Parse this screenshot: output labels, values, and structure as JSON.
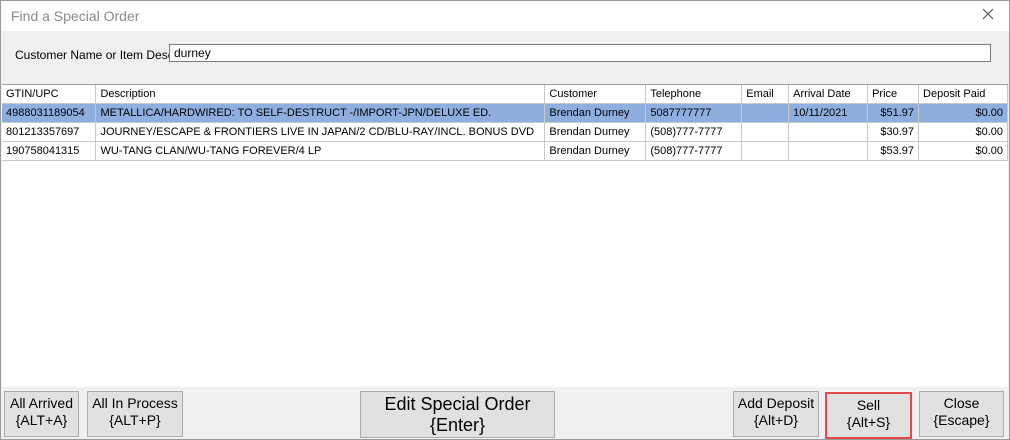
{
  "window": {
    "title": "Find a Special Order"
  },
  "filter": {
    "label": "Customer Name or Item Desc:",
    "value": "durney"
  },
  "table": {
    "columns": [
      "GTIN/UPC",
      "Description",
      "Customer",
      "Telephone",
      "Email",
      "Arrival Date",
      "Price",
      "Deposit Paid"
    ],
    "rows": [
      {
        "gtin": "4988031189054",
        "description": "METALLICA/HARDWIRED: TO SELF-DESTRUCT -/IMPORT-JPN/DELUXE ED.",
        "customer": "Brendan Durney",
        "telephone": "5087777777",
        "email": "",
        "arrival": "10/11/2021",
        "price": "$51.97",
        "deposit": "$0.00"
      },
      {
        "gtin": "801213357697",
        "description": "JOURNEY/ESCAPE & FRONTIERS LIVE IN JAPAN/2 CD/BLU-RAY/INCL. BONUS DVD",
        "customer": "Brendan Durney",
        "telephone": "(508)777-7777",
        "email": "",
        "arrival": "",
        "price": "$30.97",
        "deposit": "$0.00"
      },
      {
        "gtin": "190758041315",
        "description": "WU-TANG CLAN/WU-TANG FOREVER/4 LP",
        "customer": "Brendan Durney",
        "telephone": "(508)777-7777",
        "email": "",
        "arrival": "",
        "price": "$53.97",
        "deposit": "$0.00"
      }
    ],
    "selected_row": 0
  },
  "buttons": {
    "all_arrived": {
      "line1": "All Arrived",
      "line2": "{ALT+A}"
    },
    "all_in_process": {
      "line1": "All In Process",
      "line2": "{ALT+P}"
    },
    "edit_special_order": {
      "line1": "Edit Special Order",
      "line2": "{Enter}"
    },
    "add_deposit": {
      "line1": "Add Deposit",
      "line2": "{Alt+D}"
    },
    "sell": {
      "line1": "Sell",
      "line2": "{Alt+S}"
    },
    "close": {
      "line1": "Close",
      "line2": "{Escape}"
    }
  },
  "colors": {
    "selection": "#8faee0",
    "focus_outline": "#e04a4a",
    "window_bg": "#f0f0f0"
  }
}
